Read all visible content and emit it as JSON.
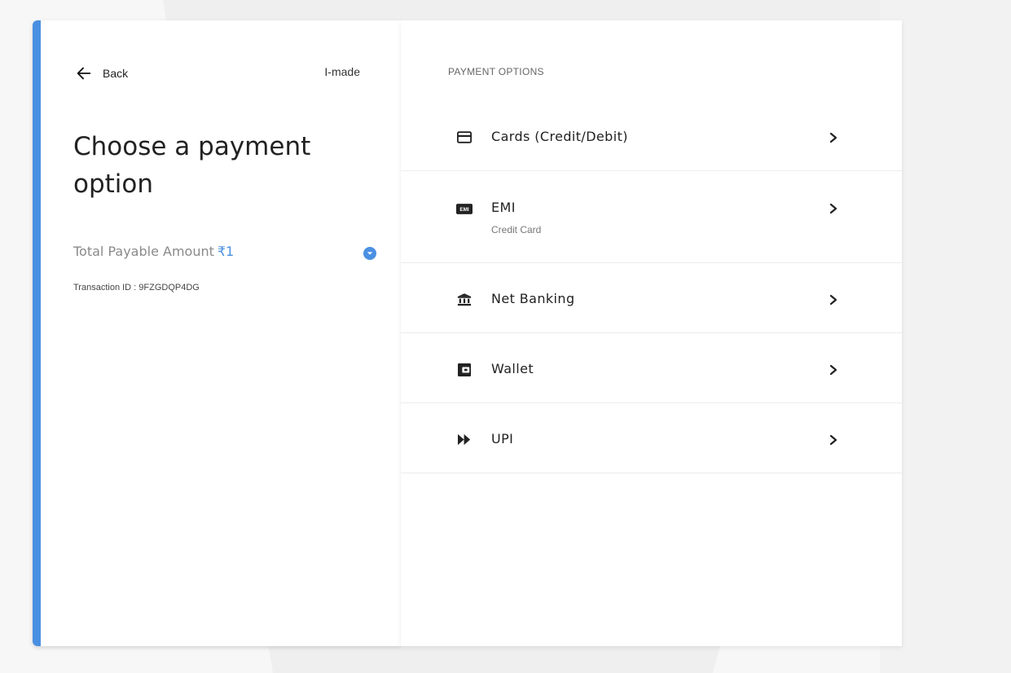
{
  "left": {
    "back_label": "Back",
    "merchant": "I-made",
    "title": "Choose a payment option",
    "amount_label": "Total Payable Amount",
    "amount_value": "₹1",
    "transaction": "Transaction ID : 9FZGDQP4DG"
  },
  "right": {
    "heading": "PAYMENT OPTIONS",
    "options": [
      {
        "label": "Cards (Credit/Debit)",
        "icon": "credit-card-icon"
      },
      {
        "label": "EMI",
        "sub": "Credit Card",
        "icon": "emi-icon",
        "icon_text": "EMI"
      },
      {
        "label": "Net Banking",
        "icon": "bank-icon"
      },
      {
        "label": "Wallet",
        "icon": "wallet-icon"
      },
      {
        "label": "UPI",
        "icon": "upi-icon"
      }
    ]
  },
  "colors": {
    "accent": "#4a90e2",
    "text": "#222222",
    "muted": "#8a8a8a"
  }
}
